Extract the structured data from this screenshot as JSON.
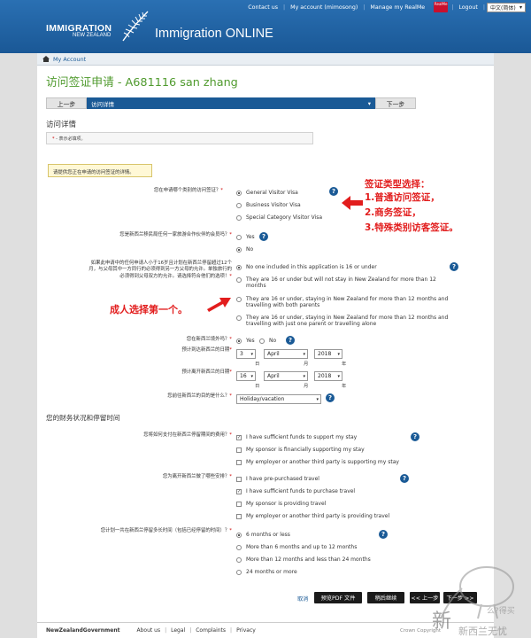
{
  "topnav": {
    "contact": "Contact us",
    "account": "My account (mimosong)",
    "realme_link": "Manage my RealMe",
    "realme_logo": "RealMe",
    "logout": "Logout",
    "language": "中文(简体)"
  },
  "brand": {
    "line1": "IMMIGRATION",
    "line2": "NEW ZEALAND",
    "app_title": "Immigration ONLINE"
  },
  "breadcrumb": {
    "label": "My Account"
  },
  "page_title": "访问签证申请 - A681116 san zhang",
  "steps": {
    "prev": "上一步",
    "current": "访问详情",
    "next": "下一步"
  },
  "section": {
    "title": "访问详情",
    "required_star": "*",
    "required_note": " - 表示必填项。"
  },
  "select_note": "请提供您正在申请的访问签证的详情。",
  "q_visa_type": {
    "label": "您在申请哪个类别的访问签证？",
    "options": [
      "General Visitor Visa",
      "Business Visitor Visa",
      "Special Category Visitor Visa"
    ],
    "selected": 0
  },
  "q_member": {
    "label": "您是新西兰移民局任何一家旅游合作伙伴的会员吗？",
    "options": [
      "Yes",
      "No"
    ],
    "selected": 1
  },
  "q_minor": {
    "label": "如果此申请中的任何申请人小于16岁且计划在新西兰停留超过12个月，与父母其中一方同行的必须得到另一方父母的允许。单独旅行的必须得到父母双方的允许。请选择符合他们的选项！",
    "options": [
      "No one included in this application is 16 or under",
      "They are 16 or under but will not stay in New Zealand for more than 12 months",
      "They are 16 or under, staying in New Zealand for more than 12 months and travelling with both parents",
      "They are 16 or under, staying in New Zealand for more than 12 months and travelling with just one parent or travelling alone"
    ],
    "selected": 0
  },
  "q_outside": {
    "label": "您在新西兰境外吗？",
    "options": [
      "Yes",
      "No"
    ],
    "selected": 0
  },
  "q_arrival": {
    "label": "预计到达新西兰的日期",
    "day": "3",
    "month": "April",
    "year": "2018"
  },
  "q_departure": {
    "label": "预计离开新西兰的日期",
    "day": "16",
    "month": "April",
    "year": "2018"
  },
  "date_units": {
    "day": "日",
    "month": "月",
    "year": "年"
  },
  "q_purpose": {
    "label": "您前往新西兰的目的是什么？",
    "value": "Holiday/vacation"
  },
  "finance_title": "您的财务状况和停留时间",
  "q_funds": {
    "label": "您将如何支付在新西兰停留期间的费用？",
    "options": [
      "I have sufficient funds to support my stay",
      "My sponsor is financially supporting my stay",
      "My employer or another third party is supporting my stay"
    ],
    "checked": [
      true,
      false,
      false
    ]
  },
  "q_onward": {
    "label": "您为离开新西兰做了哪些安排？",
    "options": [
      "I have pre-purchased travel",
      "I have sufficient funds to purchase travel",
      "My sponsor is providing travel",
      "My employer or another third party is providing travel"
    ],
    "checked": [
      false,
      true,
      false,
      false
    ]
  },
  "q_duration": {
    "label": "您计划一共在新西兰停留多长时间（包括已经停留的时间）？",
    "options": [
      "6 months or less",
      "More than 6 months and up to 12 months",
      "More than 12 months and less than 24 months",
      "24 months or more"
    ],
    "selected": 0
  },
  "actions": {
    "cancel": "取消",
    "pdf": "预览PDF 文件",
    "save": "稍后继续",
    "prev": "<< 上一步",
    "next": "下一步 >>"
  },
  "annotations": {
    "visa_title": "签证类型选择：",
    "visa_l1": "1.普通访问签证，",
    "visa_l2": "2.商务签证，",
    "visa_l3": "3.特殊类别访客签证。",
    "adult": "成人选择第一个。"
  },
  "footer": {
    "gov": "NewZealandGovernment",
    "about": "About us",
    "legal": "Legal",
    "complaints": "Complaints",
    "privacy": "Privacy",
    "copyright": "Crown Copyright"
  },
  "watermark": {
    "main": "新",
    "sub": "新西兰无忧",
    "side": "么?得买"
  },
  "colors": {
    "header": "#1f63a4",
    "title_green": "#4f9a2d",
    "step_active": "#1a5a96",
    "annotation_red": "#e21d1d"
  }
}
